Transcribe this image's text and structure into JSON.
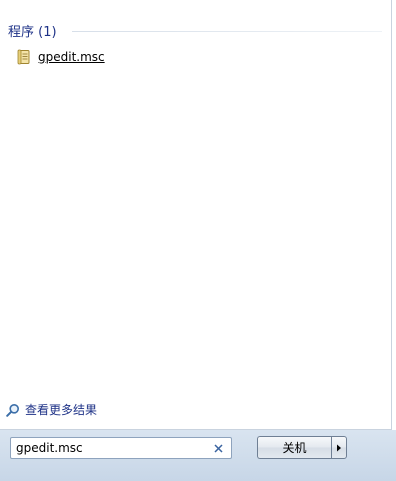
{
  "results": {
    "section_title": "程序 (1)",
    "programs": [
      {
        "label": "gpedit.msc",
        "icon": "msc-console-icon"
      }
    ],
    "see_more_label": "查看更多结果"
  },
  "search": {
    "value": "gpedit.msc"
  },
  "shutdown": {
    "label": "关机"
  },
  "colors": {
    "header_text": "#1e3287",
    "strip_top": "#d9e4f0",
    "strip_bottom": "#c7d6e7"
  }
}
